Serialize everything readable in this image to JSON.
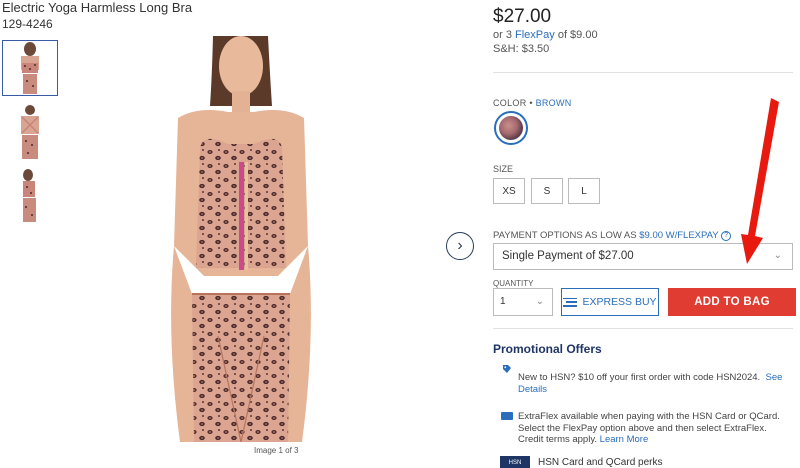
{
  "product": {
    "title": "Electric Yoga Harmless Long Bra",
    "number": "129-4246",
    "image_counter": "Image 1 of 3",
    "price": "$27.00",
    "flexpay_prefix": "or 3 ",
    "flexpay_link": "FlexPay",
    "flexpay_suffix": " of $9.00",
    "sh": "S&H: $3.50"
  },
  "color": {
    "label": "COLOR",
    "separator": " • ",
    "value": "BROWN"
  },
  "size": {
    "label": "SIZE",
    "options": [
      "XS",
      "S",
      "L"
    ]
  },
  "payment": {
    "label_prefix": "PAYMENT OPTIONS AS LOW AS ",
    "label_link": "$9.00 W/FLEXPAY",
    "help": "?",
    "selected": "Single Payment of $27.00"
  },
  "quantity": {
    "label": "QUANTITY",
    "value": "1"
  },
  "buttons": {
    "express": "EXPRESS BUY",
    "add_to_bag": "ADD TO BAG"
  },
  "promos": {
    "title": "Promotional Offers",
    "offer1_text": "New to HSN? $10 off your first order with code HSN2024.",
    "offer1_link": "See Details",
    "offer2_text": "ExtraFlex available when paying with the HSN Card or QCard. Select the FlexPay option above and then select ExtraFlex. Credit terms apply.",
    "offer2_link": "Learn More",
    "card_badge": "HSN",
    "card_perks": "HSN Card and QCard perks"
  },
  "icons": {
    "next": "chevron-right-icon",
    "dropdown": "chevron-down-icon",
    "express": "express-lines-icon",
    "tag": "tag-icon",
    "card": "credit-card-icon"
  },
  "colors": {
    "accent": "#2a6ebb",
    "add_button": "#e03c31",
    "heading": "#1f3566",
    "annotation_arrow": "#e8190f"
  }
}
